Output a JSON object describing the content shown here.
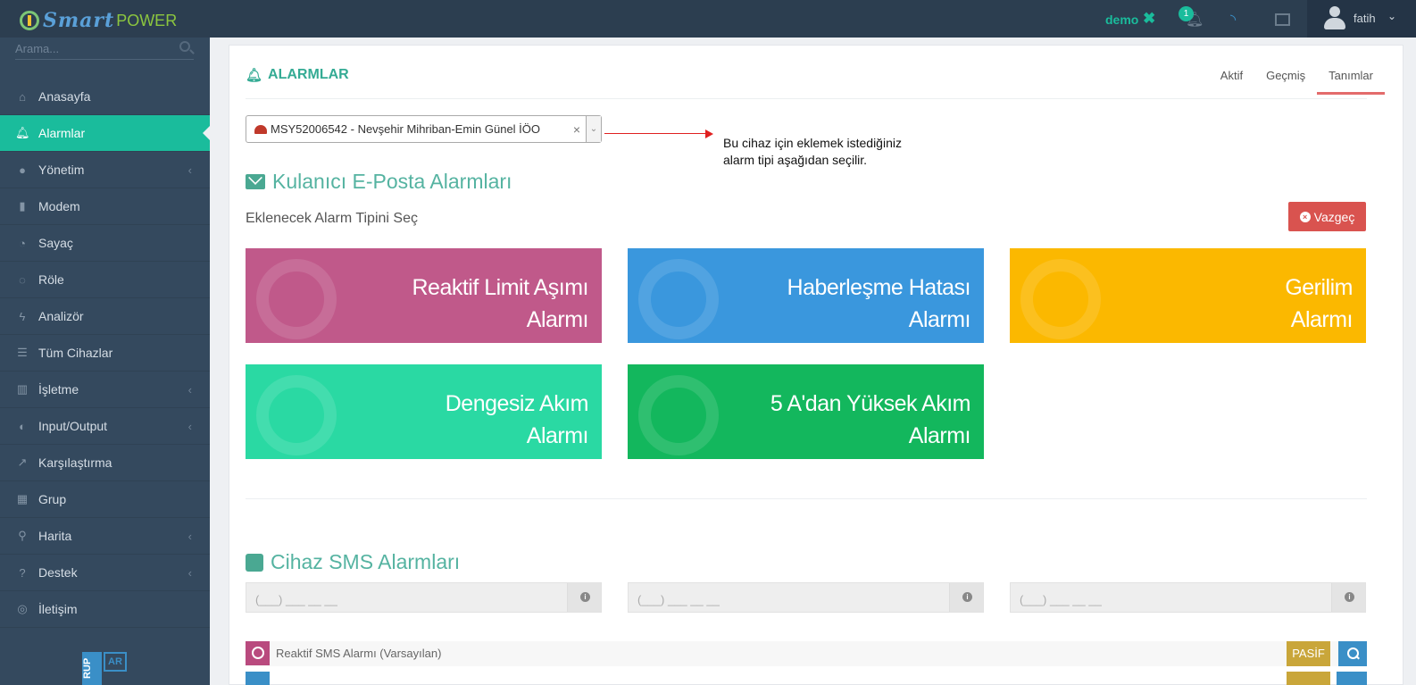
{
  "app": {
    "logo_smart": "Smart",
    "logo_power": "POWER",
    "session_label": "demo",
    "session_close": "✖",
    "notification_count": "1",
    "user_name": "fatih",
    "user_caret": "⌄"
  },
  "sidebar": {
    "search_placeholder": "Arama...",
    "items": [
      {
        "label": "Anasayfa",
        "icon": "home-icon",
        "glyph": "⌂"
      },
      {
        "label": "Alarmlar",
        "icon": "bell-icon",
        "glyph": "🔔︎",
        "active": true
      },
      {
        "label": "Yönetim",
        "icon": "users-icon",
        "glyph": "●",
        "caret": "‹"
      },
      {
        "label": "Modem",
        "icon": "signal-icon",
        "glyph": "▮"
      },
      {
        "label": "Sayaç",
        "icon": "gauge-icon",
        "glyph": "◔"
      },
      {
        "label": "Röle",
        "icon": "relay-icon",
        "glyph": "◌"
      },
      {
        "label": "Analizör",
        "icon": "bolt-icon",
        "glyph": "ϟ"
      },
      {
        "label": "Tüm Cihazlar",
        "icon": "database-icon",
        "glyph": "☰"
      },
      {
        "label": "İşletme",
        "icon": "building-icon",
        "glyph": "▥",
        "caret": "‹"
      },
      {
        "label": "Input/Output",
        "icon": "toggle-icon",
        "glyph": "◐",
        "caret": "‹"
      },
      {
        "label": "Karşılaştırma",
        "icon": "line-chart-icon",
        "glyph": "↗"
      },
      {
        "label": "Grup",
        "icon": "grid-icon",
        "glyph": "▦"
      },
      {
        "label": "Harita",
        "icon": "map-marker-icon",
        "glyph": "⚲",
        "caret": "‹"
      },
      {
        "label": "Destek",
        "icon": "question-icon",
        "glyph": "?",
        "caret": "‹"
      },
      {
        "label": "İletişim",
        "icon": "globe-icon",
        "glyph": "◎"
      }
    ],
    "brand_left": "RUP",
    "brand_right": "AR"
  },
  "main": {
    "title": "ALARMLAR",
    "tabs": [
      {
        "label": "Aktif"
      },
      {
        "label": "Geçmiş"
      },
      {
        "label": "Tanımlar",
        "active": true
      }
    ],
    "device_select": {
      "value": "MSY52006542 - Nevşehir Mihriban-Emin Günel İÖO",
      "clear": "×",
      "arrow": "⌄"
    },
    "note_line1": "Bu cihaz için eklemek istediğiniz",
    "note_line2": "alarm tipi aşağıdan seçilir.",
    "email_section": {
      "title": "Kulanıcı E-Posta Alarmları",
      "subtitle": "Eklenecek Alarm Tipini Seç",
      "cancel_label": "Vazgeç",
      "cancel_icon": "×",
      "tiles": [
        {
          "line1": "Reaktif Limit Aşımı",
          "line2": "Alarmı",
          "color": "#c0598a",
          "icon": "gauge-icon"
        },
        {
          "line1": "Haberleşme Hatası",
          "line2": "Alarmı",
          "color": "#3a97dd",
          "icon": "usb-icon"
        },
        {
          "line1": "Gerilim",
          "line2": "Alarmı",
          "color": "#fbb800",
          "icon": "plug-icon"
        },
        {
          "line1": "Dengesiz Akım",
          "line2": "Alarmı",
          "color": "#2ad9a3",
          "icon": "shuffle-icon"
        },
        {
          "line1": "5 A'dan Yüksek Akım",
          "line2": "Alarmı",
          "color": "#13b75d",
          "icon": "arrow-up-icon"
        }
      ]
    },
    "sms_section": {
      "title": "Cihaz SMS Alarmları",
      "phone_placeholder": "(___) ___ __ __",
      "info_glyph": "i",
      "rows": [
        {
          "label": "Reaktif SMS Alarmı (Varsayılan)",
          "status": "PASİF"
        }
      ]
    }
  }
}
